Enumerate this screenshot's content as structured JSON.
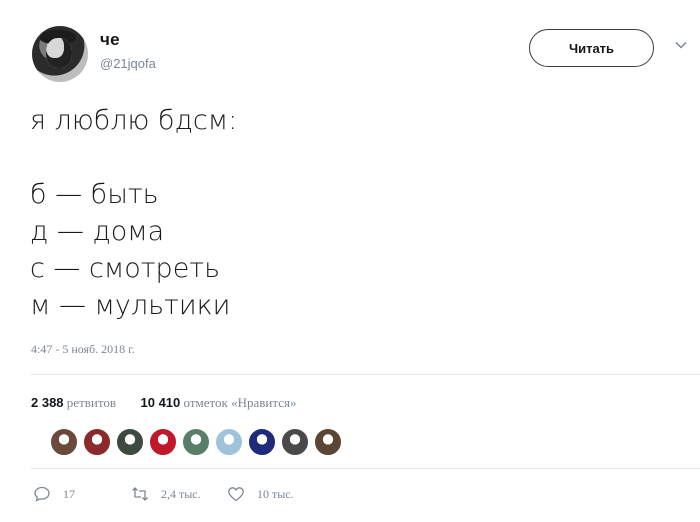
{
  "author": {
    "name": "че",
    "handle": "@21jqofa"
  },
  "follow_button": {
    "label": "Читать"
  },
  "tweet": {
    "lines": [
      "я люблю бдсм:",
      "",
      "б — быть",
      "д — дома",
      "с — смотреть",
      "м — мультики"
    ],
    "timestamp": "4:47 - 5 нояб. 2018 г."
  },
  "stats": {
    "retweets_count": "2 388",
    "retweets_label": "ретвитов",
    "likes_count": "10 410",
    "likes_label": "отметок «Нравится»"
  },
  "likers": {
    "colors": [
      "#6a4a3a",
      "#8b2a2a",
      "#3d4a3f",
      "#c0182a",
      "#5a7d6a",
      "#9fc3d8",
      "#1d2b7a",
      "#4a4a4a",
      "#5b4636"
    ]
  },
  "actions": {
    "replies": "17",
    "retweets": "2,4 тыс.",
    "likes": "10 тыс."
  }
}
